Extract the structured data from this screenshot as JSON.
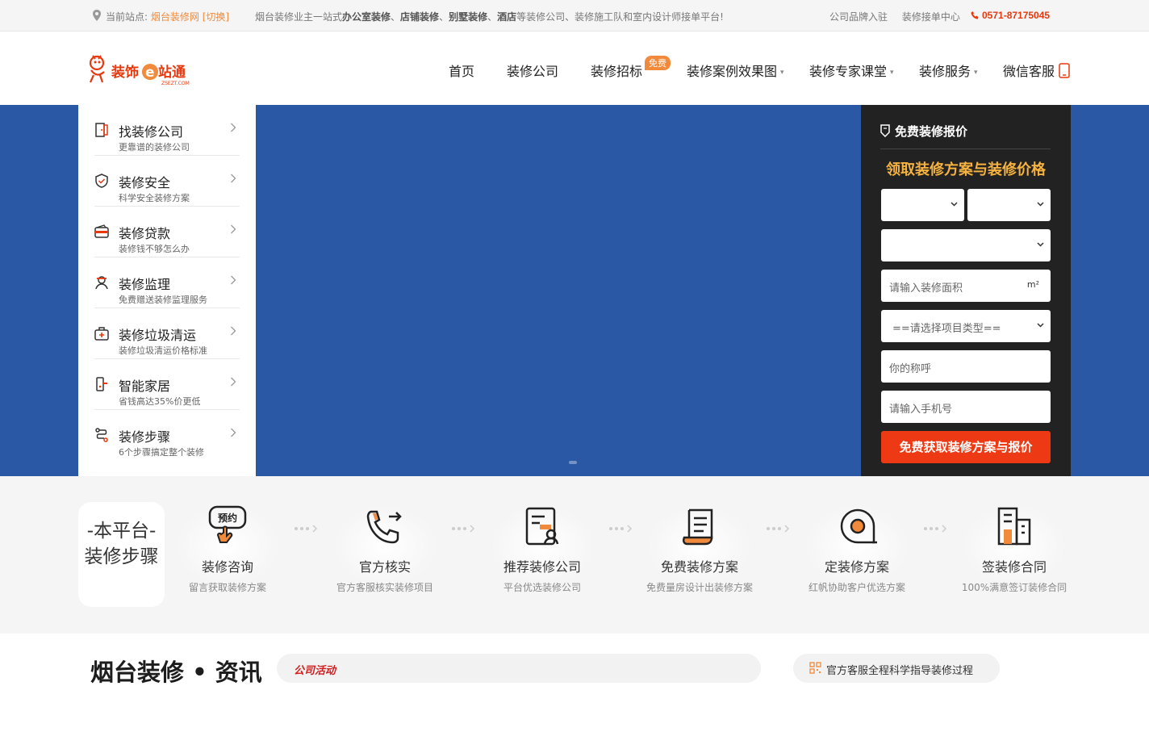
{
  "topbar": {
    "site_prefix": "当前站点:",
    "site_name": "烟台装修网",
    "site_switch": "[切换]",
    "slogan_pre": "烟台装修业主一站式",
    "slogan_b1": "办公室装修",
    "slogan_s1": "、",
    "slogan_b2": "店铺装修",
    "slogan_s2": "、",
    "slogan_b3": "别墅装修",
    "slogan_s3": "、",
    "slogan_b4": "酒店",
    "slogan_post": "等装修公司、装修施工队和室内设计师接单平台!",
    "link_brand": "公司品牌入驻",
    "link_orders": "装修接单中心",
    "phone": "0571-87175045"
  },
  "header": {
    "logo_text": "装饰e站通",
    "logo_domain": "ZSEZT.COM",
    "nav": {
      "home": "首页",
      "companies": "装修公司",
      "bidding": "装修招标",
      "bidding_badge": "免费",
      "cases": "装修案例效果图",
      "classroom": "装修专家课堂",
      "services": "装修服务",
      "wechat": "微信客服"
    }
  },
  "side_menu": {
    "items": [
      {
        "title": "找装修公司",
        "sub": "更靠谱的装修公司",
        "icon": "door-icon"
      },
      {
        "title": "装修安全",
        "sub": "科学安全装修方案",
        "icon": "shield-check-icon"
      },
      {
        "title": "装修贷款",
        "sub": "装修钱不够怎么办",
        "icon": "wallet-icon"
      },
      {
        "title": "装修监理",
        "sub": "免费赠送装修监理服务",
        "icon": "supervisor-icon"
      },
      {
        "title": "装修垃圾清运",
        "sub": "装修垃圾清运价格标准",
        "icon": "medkit-icon"
      },
      {
        "title": "智能家居",
        "sub": "省钱高达35%价更低",
        "icon": "smart-lock-icon"
      },
      {
        "title": "装修步骤",
        "sub": "6个步骤搞定整个装修",
        "icon": "route-icon"
      }
    ]
  },
  "quote": {
    "heading": "免费装修报价",
    "title": "领取装修方案与装修价格",
    "select_province": "",
    "select_city": "",
    "select_district": "",
    "area_placeholder": "请输入装修面积",
    "area_unit": "m²",
    "type_placeholder": "==请选择项目类型==",
    "name_placeholder": "你的称呼",
    "phone_placeholder": "请输入手机号",
    "submit": "免费获取装修方案与报价"
  },
  "steps": {
    "label_line1": "-本平台-",
    "label_line2": "装修步骤",
    "items": [
      {
        "title": "装修咨询",
        "sub": "留言获取装修方案",
        "icon": "appointment-icon",
        "icon_text": "预约"
      },
      {
        "title": "官方核实",
        "sub": "官方客服核实装修项目",
        "icon": "phone-call-icon"
      },
      {
        "title": "推荐装修公司",
        "sub": "平台优选装修公司",
        "icon": "recommend-icon"
      },
      {
        "title": "免费装修方案",
        "sub": "免费量房设计出装修方案",
        "icon": "scroll-icon"
      },
      {
        "title": "定装修方案",
        "sub": "红帆协助客户优选方案",
        "icon": "tape-measure-icon"
      },
      {
        "title": "签装修合同",
        "sub": "100%满意签订装修合同",
        "icon": "building-icon"
      }
    ]
  },
  "news": {
    "title": "烟台装修 • 资讯",
    "tab_active": "公司活动",
    "service_text": "官方客服全程科学指导装修过程"
  },
  "colors": {
    "accent_orange": "#f08a3c",
    "banner_blue": "#2b58a5",
    "submit_red": "#ee3a14",
    "quote_gold": "#f6b340",
    "phone_red": "#e8380d"
  }
}
